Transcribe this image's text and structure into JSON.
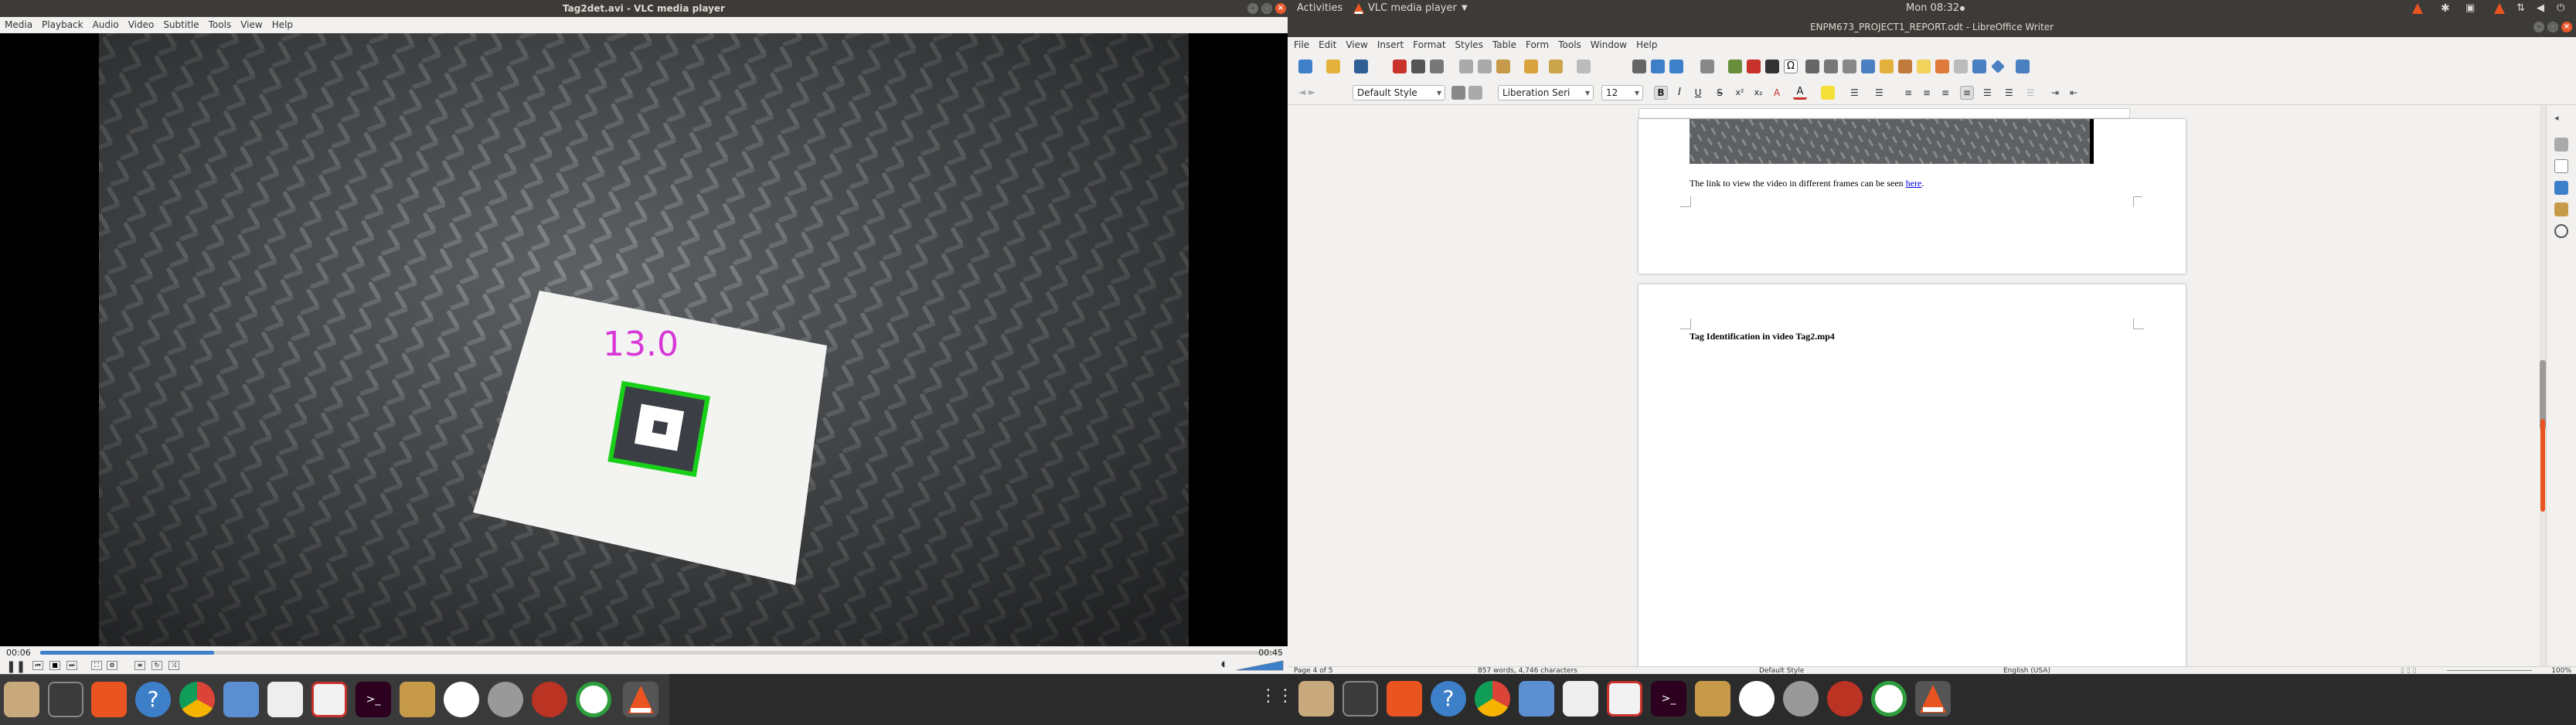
{
  "gnome": {
    "activities": "Activities",
    "app_menu": "VLC media player",
    "clock": "Mon 08:32"
  },
  "vlc": {
    "title": "Tag2det.avi - VLC media player",
    "menu": [
      "Media",
      "Playback",
      "Audio",
      "Video",
      "Subtitle",
      "Tools",
      "View",
      "Help"
    ],
    "overlay_number": "13.0",
    "time_elapsed": "00:06",
    "time_total": "00:45",
    "progress": 0.14,
    "volume": 1.0
  },
  "writer": {
    "title": "ENPM673_PROJECT1_REPORT.odt - LibreOffice Writer",
    "menu": [
      "File",
      "Edit",
      "View",
      "Insert",
      "Format",
      "Styles",
      "Table",
      "Form",
      "Tools",
      "Window",
      "Help"
    ],
    "para_style": "Default Style",
    "font_name": "Liberation Seri",
    "font_size": "12",
    "body_text_prefix": "The link to view the video in different frames can be seen ",
    "link_text": "here",
    "body_text_suffix": ".",
    "heading": "Tag Identification in video Tag2.mp4",
    "status": {
      "page": "Page 4 of 5",
      "words": "857 words, 4,746 characters",
      "style": "Default Style",
      "language": "English (USA)",
      "zoom": "100%"
    }
  },
  "colors": {
    "overlay_text": "#d838d8",
    "tag_border": "#19d019",
    "vlc_accent": "#3d7fc9",
    "ubuntu_orange": "#e95420"
  },
  "dock_icons": [
    "files-icon",
    "camera-icon",
    "software-icon",
    "help-icon",
    "chrome-icon",
    "document-viewer-icon",
    "text-editor-icon",
    "foxit-icon",
    "terminal-icon",
    "archive-icon",
    "slack-icon",
    "settings-icon",
    "spider-icon",
    "sync-icon",
    "vlc-icon"
  ]
}
